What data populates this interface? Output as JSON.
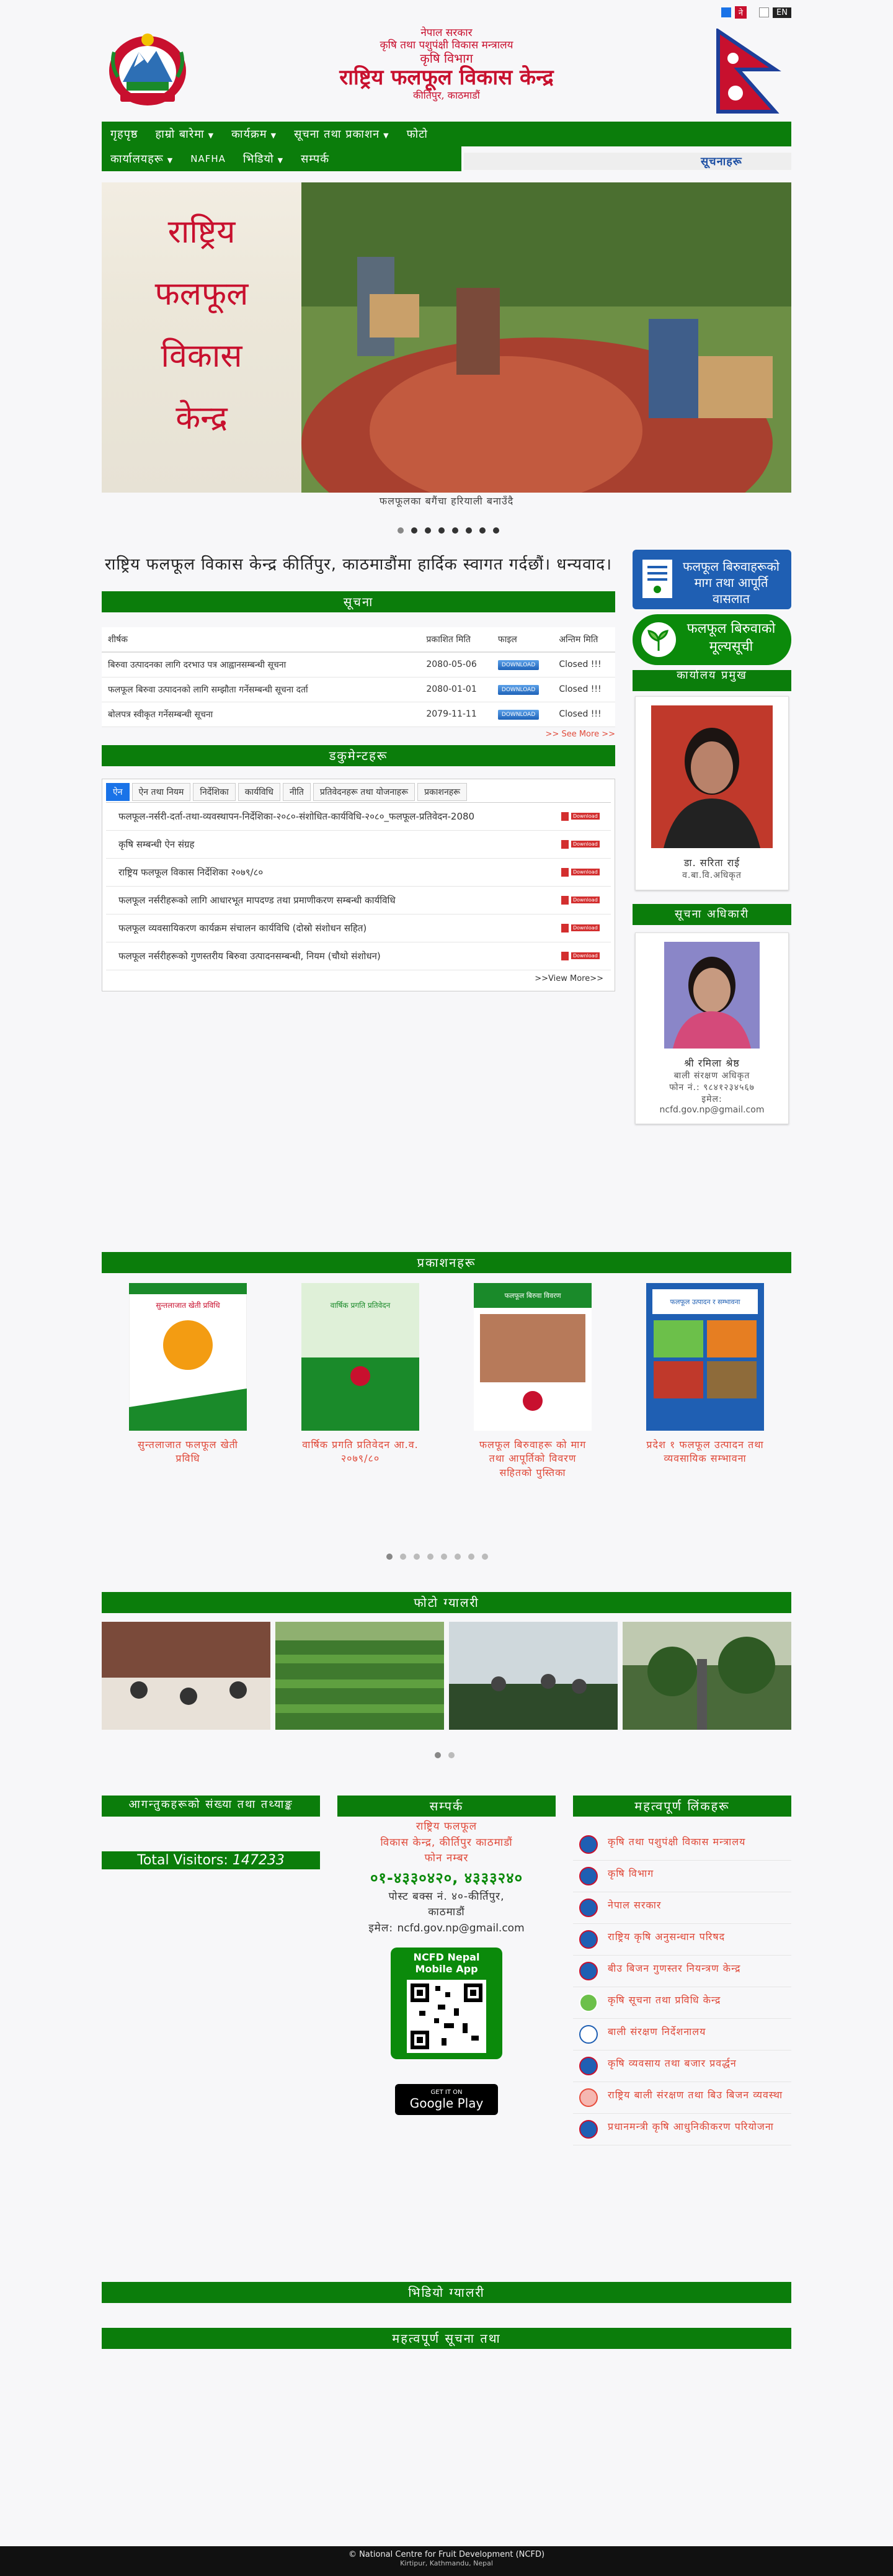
{
  "lang": {
    "ne": "ने",
    "en": "EN"
  },
  "header": {
    "line1": "नेपाल सरकार",
    "line2": "कृषि तथा पशुपंक्षी विकास मन्त्रालय",
    "line3": "कृषि विभाग",
    "line4": "राष्ट्रिय फलफूल विकास केन्द्र",
    "line5": "कीर्तिपुर, काठमाडौं"
  },
  "nav": {
    "row1": [
      {
        "label": "गृहपृष्ठ",
        "dropdown": false
      },
      {
        "label": "हाम्रो बारेमा",
        "dropdown": true
      },
      {
        "label": "कार्यक्रम",
        "dropdown": true
      },
      {
        "label": "सूचना तथा प्रकाशन",
        "dropdown": true
      },
      {
        "label": "फोटो",
        "dropdown": false
      }
    ],
    "row2": [
      {
        "label": "कार्यालयहरू",
        "dropdown": true
      },
      {
        "label": "NAFHA",
        "dropdown": false
      },
      {
        "label": "भिडियो",
        "dropdown": true
      },
      {
        "label": "सम्पर्क",
        "dropdown": false
      }
    ]
  },
  "ticker": "सूचनाहरू",
  "banner": {
    "words": [
      "राष्ट्रिय",
      "फलफूल",
      "विकास",
      "केन्द्र"
    ],
    "caption": "फलफूलका बगैंचा हरियाली बनाउँदै"
  },
  "welcome": "राष्ट्रिय फलफूल विकास केन्द्र कीर्तिपुर, काठमाडौंमा हार्दिक स्वागत गर्दछौं। धन्यवाद।",
  "notices": {
    "title": "सूचना",
    "headers": [
      "शीर्षक",
      "प्रकाशित मिति",
      "फाइल",
      "अन्तिम मिति"
    ],
    "rows": [
      {
        "title": "बिरुवा उत्पादनका लागि दरभाउ पत्र आह्वानसम्बन्धी सूचना",
        "date": "2080-05-06",
        "status": "Closed !!!"
      },
      {
        "title": "फलफूल बिरुवा उत्पादनको लागि सम्झौता गर्नेसम्बन्धी सूचना दर्ता",
        "date": "2080-01-01",
        "status": "Closed !!!"
      },
      {
        "title": "बोलपत्र स्वीकृत गर्नेसम्बन्धी सूचना",
        "date": "2079-11-11",
        "status": "Closed !!!"
      }
    ],
    "see_more": ">> See More >>",
    "download_label": "DOWNLOAD"
  },
  "documents": {
    "title": "डकुमेन्टहरू",
    "tabs": [
      "ऐन",
      "ऐन तथा नियम",
      "निर्देशिका",
      "कार्यविधि",
      "नीति",
      "प्रतिवेदनहरू तथा योजनाहरू",
      "प्रकाशनहरू"
    ],
    "active_tab": 0,
    "items": [
      "फलफूल-नर्सरी-दर्ता-तथा-व्यवस्थापन-निर्देशिका-२०८०-संशोधित-कार्यविधि-२०८०_फलफूल-प्रतिवेदन-2080",
      "कृषि सम्बन्धी ऐन संग्रह",
      "राष्ट्रिय फलफूल विकास निर्देशिका २०७९/८०",
      "फलफूल नर्सरीहरूको लागि आधारभूत मापदण्ड तथा प्रमाणीकरण सम्बन्धी कार्यविधि",
      "फलफूल व्यवसायिकरण कार्यक्रम संचालन कार्यविधि (दोस्रो संशोधन सहित)",
      "फलफूल नर्सरीहरूको गुणस्तरीय बिरुवा उत्पादनसम्बन्धी, नियम (चौथो संशोधन)"
    ],
    "view_more": ">>View More>>"
  },
  "sidebar": {
    "banner1": "फलफूल बिरुवाहरूको माग तथा आपूर्ति वासलात",
    "banner2": "फलफूल बिरुवाको मूल्यसूची",
    "chief": {
      "heading": "कार्यालय प्रमुख",
      "name": "डा. सरिता राई",
      "title": "व.बा.वि.अधिकृत"
    },
    "info_officer": {
      "heading": "सूचना अधिकारी",
      "name": "श्री रमिला श्रेष्ठ",
      "title": "बाली संरक्षण अधिकृत",
      "phone_label": "फोन नं.:",
      "phone": "९८४१२३४५६७",
      "email_label": "इमेल:",
      "email": "ncfd.gov.np@gmail.com"
    }
  },
  "publications": {
    "title": "प्रकाशनहरू",
    "items": [
      {
        "title": "सुन्तलाजात फलफूल खेती प्रविधि",
        "cover_top": "सुन्तलाजात खेती प्रविधि"
      },
      {
        "title": "वार्षिक प्रगति प्रतिवेदन आ.व. २०७९/८०",
        "cover_top": "वार्षिक प्रगति प्रतिवेदन"
      },
      {
        "title": "फलफूल बिरुवाहरू को माग तथा आपूर्तिको विवरण सहितको पुस्तिका",
        "cover_top": "फलफूल बिरुवा विवरण"
      },
      {
        "title": "प्रदेश १ फलफूल उत्पादन तथा व्यवसायिक सम्भावना",
        "cover_top": "फलफूल उत्पादन र सम्भावना"
      }
    ]
  },
  "gallery": {
    "title": "फोटो ग्यालरी"
  },
  "visitors": {
    "heading": "आगन्तुकहरूको संख्या तथा तथ्याङ्क",
    "label": "Total Visitors:",
    "count": "147233"
  },
  "contact": {
    "heading": "सम्पर्क",
    "l1": "राष्ट्रिय फलफूल",
    "l2": "विकास केन्द्र, कीर्तिपुर काठमाडौं",
    "l3": "फोन नम्बर",
    "l4": "०१-४३३०४२०, ४३३३२४०",
    "l5": "पोस्ट बक्स नं. ४०-कीर्तिपुर,",
    "l6": "काठमाडौं",
    "email_label": "इमेल:",
    "email": "ncfd.gov.np@gmail.com",
    "app_title": "NCFD Nepal",
    "app_subtitle": "Mobile App",
    "gplay_small": "GET IT ON",
    "gplay_big": "Google Play"
  },
  "links": {
    "heading": "महत्वपूर्ण लिंकहरू",
    "items": [
      "कृषि तथा पशुपंक्षी विकास मन्त्रालय",
      "कृषि विभाग",
      "नेपाल सरकार",
      "राष्ट्रिय कृषि अनुसन्धान परिषद",
      "बीउ बिजन गुणस्तर नियन्त्रण केन्द्र",
      "कृषि सूचना तथा प्रविधि केन्द्र",
      "बाली संरक्षण निर्देशनालय",
      "कृषि व्यवसाय तथा बजार प्रवर्द्धन",
      "राष्ट्रिय बाली संरक्षण तथा बिउ बिजन व्यवस्था",
      "प्रधानमन्त्री कृषि आधुनिकीकरण परियोजना"
    ]
  },
  "sections": {
    "s1": "भिडियो ग्यालरी",
    "s2": "महत्वपूर्ण सूचना तथा"
  },
  "footer": {
    "line1": "© National Centre for Fruit Development (NCFD)",
    "line2": "Kirtipur, Kathmandu, Nepal"
  },
  "colors": {
    "green": "#0b7d0b",
    "red": "#c8102e",
    "link": "#e04a3a",
    "blue": "#1f5fb3"
  }
}
